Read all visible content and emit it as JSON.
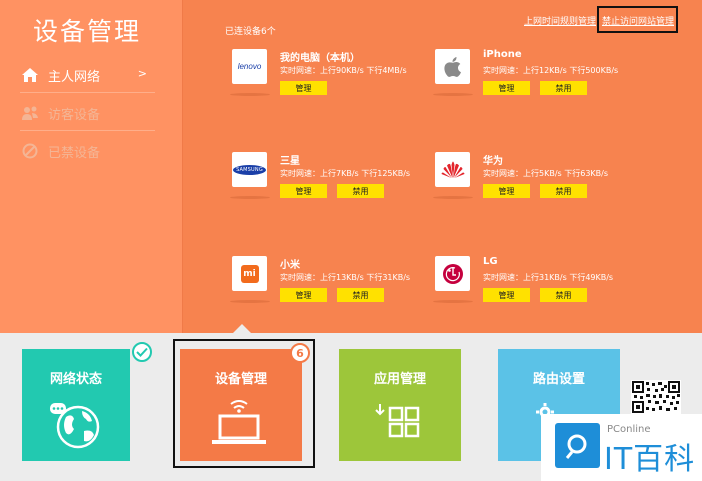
{
  "app": {
    "title": "设备管理"
  },
  "sidebar": {
    "items": [
      {
        "label": "主人网络",
        "arrow": ">"
      },
      {
        "label": "访客设备"
      },
      {
        "label": "已禁设备"
      }
    ]
  },
  "header": {
    "link_schedule": "上网时间规则管理",
    "link_block": "禁止访问网站管理"
  },
  "main": {
    "connected_label": "已连设备6个",
    "devices": [
      {
        "name": "我的电脑（本机）",
        "speed": "实时网速：上行90KB/s 下行4MB/s",
        "logo": "lenovo",
        "manage": "管理"
      },
      {
        "name": "iPhone",
        "speed": "实时网速：上行12KB/s 下行500KB/s",
        "logo": "apple-icon",
        "manage": "管理",
        "ban": "禁用"
      },
      {
        "name": "三星",
        "speed": "实时网速：上行7KB/s 下行125KB/s",
        "logo": "SAMSUNG",
        "manage": "管理",
        "ban": "禁用"
      },
      {
        "name": "华为",
        "speed": "实时网速：上行5KB/s 下行63KB/s",
        "logo": "huawei-icon",
        "manage": "管理",
        "ban": "禁用"
      },
      {
        "name": "小米",
        "speed": "实时网速：上行13KB/s 下行31KB/s",
        "logo": "mi",
        "manage": "管理",
        "ban": "禁用"
      },
      {
        "name": "LG",
        "speed": "实时网速：上行31KB/s 下行49KB/s",
        "logo": "lg-icon",
        "manage": "管理",
        "ban": "禁用"
      }
    ]
  },
  "nav": {
    "tiles": [
      {
        "label": "网络状态",
        "color": "#22c9b0",
        "icon": "globe-icon"
      },
      {
        "label": "设备管理",
        "color": "#f47a47",
        "icon": "laptop-icon",
        "badge": "6"
      },
      {
        "label": "应用管理",
        "color": "#9dc63a",
        "icon": "apps-grid-icon"
      },
      {
        "label": "路由设置",
        "color": "#5bc2e7",
        "icon": "gear-icon"
      }
    ]
  },
  "brand": {
    "small": "PConline",
    "big": "IT百科"
  },
  "colors": {
    "sidebar": "#ff9262",
    "main": "#f7834f",
    "button": "#ffe100",
    "bottom": "#ececec"
  }
}
